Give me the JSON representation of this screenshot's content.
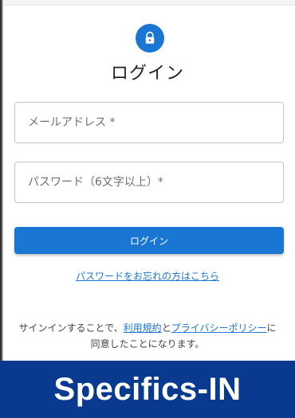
{
  "login": {
    "title": "ログイン",
    "email_placeholder": "メールアドレス *",
    "password_placeholder": "パスワード（6文字以上）*",
    "submit_label": "ログイン",
    "forgot_link": "パスワードをお忘れの方はこちら"
  },
  "terms": {
    "prefix": "サインインすることで、",
    "terms_link": "利用規約",
    "and": "と",
    "privacy_link": "プライバシーポリシー",
    "suffix": "に同意したことになります。"
  },
  "banner": {
    "text": "Specifics-IN"
  },
  "colors": {
    "accent": "#1976d2",
    "banner": "#0a3a8f"
  },
  "icons": {
    "header": "lock-icon"
  }
}
